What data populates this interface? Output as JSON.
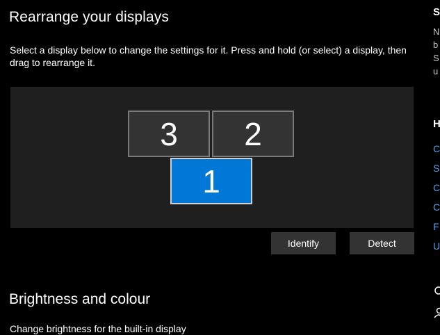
{
  "section1": {
    "title": "Rearrange your displays",
    "description": "Select a display below to change the settings for it. Press and hold (or select) a display, then drag to rearrange it."
  },
  "displays": [
    {
      "label": "3",
      "selected": false
    },
    {
      "label": "2",
      "selected": false
    },
    {
      "label": "1",
      "selected": true
    }
  ],
  "buttons": {
    "identify": "Identify",
    "detect": "Detect"
  },
  "section2": {
    "title": "Brightness and colour",
    "subtitle": "Change brightness for the built-in display"
  },
  "side": {
    "heading1": "S",
    "text": [
      "N",
      "b",
      "S",
      "u"
    ],
    "heading2": "H",
    "links": [
      "C",
      "S",
      "C",
      "C",
      "F",
      "U"
    ]
  },
  "colors": {
    "accent": "#0078d7",
    "link": "#4da3f0",
    "panel": "#1f1f1f",
    "monitor": "#333333"
  }
}
